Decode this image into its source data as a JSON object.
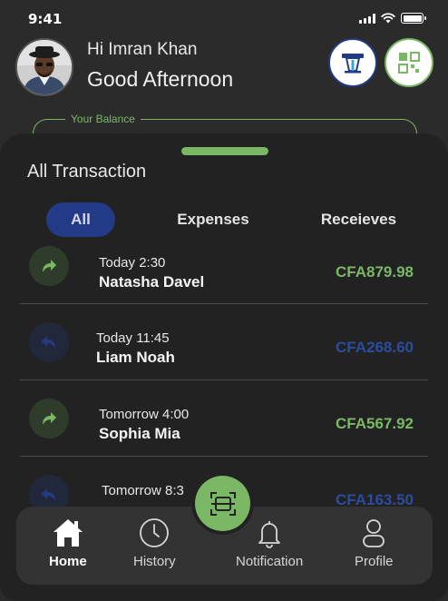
{
  "status_bar": {
    "time": "9:41"
  },
  "header": {
    "greeting": "Hi Imran Khan",
    "salutation": "Good Afternoon",
    "balance_label": "Your Balance"
  },
  "sheet": {
    "title": "All Transaction",
    "tabs": [
      {
        "label": "All",
        "active": true
      },
      {
        "label": "Expenses",
        "active": false
      },
      {
        "label": "Receieves",
        "active": false
      }
    ]
  },
  "transactions": [
    {
      "time": "Today 2:30",
      "name": "Natasha Davel",
      "amount": "CFA879.98",
      "direction": "sent"
    },
    {
      "time": "Today 11:45",
      "name": "Liam Noah",
      "amount": "CFA268.60",
      "direction": "received"
    },
    {
      "time": "Tomorrow 4:00",
      "name": "Sophia Mia",
      "amount": "CFA567.92",
      "direction": "sent"
    },
    {
      "time": "Tomorrow 8:3",
      "name": "",
      "amount": "CFA163.50",
      "direction": "received"
    }
  ],
  "nav": {
    "items": [
      {
        "label": "Home",
        "icon": "home-icon",
        "active": true
      },
      {
        "label": "History",
        "icon": "clock-icon",
        "active": false
      },
      {
        "label": "Notification",
        "icon": "bell-icon",
        "active": false
      },
      {
        "label": "Profile",
        "icon": "user-icon",
        "active": false
      }
    ],
    "center_icon": "scan-icon"
  },
  "colors": {
    "accent_green": "#7ab865",
    "accent_blue": "#233a86",
    "background": "#2b2b2b",
    "sheet": "#222222"
  }
}
